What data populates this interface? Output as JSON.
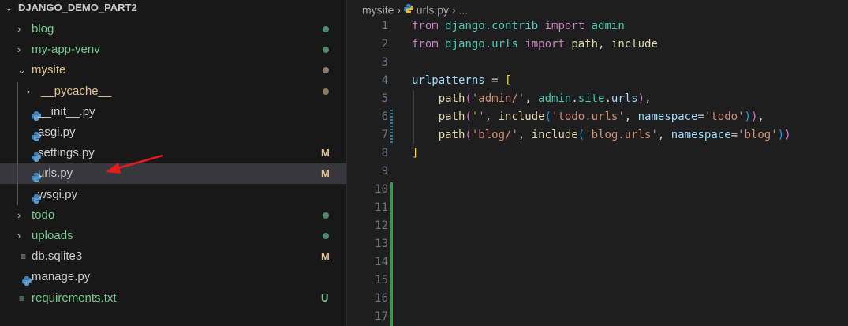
{
  "explorer": {
    "root": "DJANGO_DEMO_PART2",
    "items": [
      {
        "label": "blog",
        "type": "folder",
        "open": false,
        "depth": 1,
        "color": "#73c991",
        "status": "dot",
        "status_color": "#4b8b6b"
      },
      {
        "label": "my-app-venv",
        "type": "folder",
        "open": false,
        "depth": 1,
        "color": "#73c991",
        "status": "dot",
        "status_color": "#4b8b6b"
      },
      {
        "label": "mysite",
        "type": "folder",
        "open": true,
        "depth": 1,
        "color": "#e2c08d",
        "status": "dot",
        "status_color": "#8a7a5e"
      },
      {
        "label": "__pycache__",
        "type": "folder",
        "open": false,
        "depth": 2,
        "color": "#e2c08d",
        "status": "dot",
        "status_color": "#8a7a5e"
      },
      {
        "label": "__init__.py",
        "type": "py",
        "depth": 2,
        "color": "#cccccc",
        "status": ""
      },
      {
        "label": "asgi.py",
        "type": "py",
        "depth": 2,
        "color": "#cccccc",
        "status": ""
      },
      {
        "label": "settings.py",
        "type": "py",
        "depth": 2,
        "color": "#cccccc",
        "status": "M",
        "status_color": "#e2c08d"
      },
      {
        "label": "urls.py",
        "type": "py",
        "depth": 2,
        "color": "#cccccc",
        "status": "M",
        "status_color": "#e2c08d",
        "selected": true
      },
      {
        "label": "wsgi.py",
        "type": "py",
        "depth": 2,
        "color": "#cccccc",
        "status": ""
      },
      {
        "label": "todo",
        "type": "folder",
        "open": false,
        "depth": 1,
        "color": "#73c991",
        "status": "dot",
        "status_color": "#4b8b6b"
      },
      {
        "label": "uploads",
        "type": "folder",
        "open": false,
        "depth": 1,
        "color": "#73c991",
        "status": "dot",
        "status_color": "#4b8b6b"
      },
      {
        "label": "db.sqlite3",
        "type": "db",
        "depth": 1,
        "color": "#cccccc",
        "status": "M",
        "status_color": "#e2c08d"
      },
      {
        "label": "manage.py",
        "type": "py",
        "depth": 1,
        "color": "#cccccc",
        "status": ""
      },
      {
        "label": "requirements.txt",
        "type": "txt",
        "depth": 1,
        "color": "#73c991",
        "status": "U",
        "status_color": "#73c991"
      }
    ]
  },
  "breadcrumb": {
    "folder": "mysite",
    "file": "urls.py",
    "more": "..."
  },
  "code": {
    "line_numbers": [
      "1",
      "2",
      "3",
      "4",
      "5",
      "6",
      "7",
      "8",
      "9",
      "10",
      "11",
      "12",
      "13",
      "14",
      "15",
      "16",
      "17"
    ],
    "lines": [
      [
        [
          "from",
          "kw"
        ],
        [
          " ",
          ""
        ],
        [
          "django.contrib",
          "mod"
        ],
        [
          " ",
          ""
        ],
        [
          "import",
          "kw"
        ],
        [
          " ",
          ""
        ],
        [
          "admin",
          "mod"
        ]
      ],
      [
        [
          "from",
          "kw"
        ],
        [
          " ",
          ""
        ],
        [
          "django.urls",
          "mod"
        ],
        [
          " ",
          ""
        ],
        [
          "import",
          "kw"
        ],
        [
          " ",
          ""
        ],
        [
          "path",
          "fn"
        ],
        [
          ", ",
          ""
        ],
        [
          "include",
          "fn"
        ]
      ],
      [],
      [
        [
          "urlpatterns",
          "var"
        ],
        [
          " = ",
          ""
        ],
        [
          "[",
          "b1"
        ]
      ],
      [
        [
          "    ",
          ""
        ],
        [
          "path",
          "fn"
        ],
        [
          "(",
          "b2"
        ],
        [
          "'admin/'",
          "str"
        ],
        [
          ", ",
          ""
        ],
        [
          "admin",
          "mod"
        ],
        [
          ".",
          ""
        ],
        [
          "site",
          "mod"
        ],
        [
          ".",
          ""
        ],
        [
          "urls",
          "var"
        ],
        [
          ")",
          "b2"
        ],
        [
          ",",
          ""
        ]
      ],
      [
        [
          "    ",
          ""
        ],
        [
          "path",
          "fn"
        ],
        [
          "(",
          "b2"
        ],
        [
          "''",
          "str"
        ],
        [
          ", ",
          ""
        ],
        [
          "include",
          "fn"
        ],
        [
          "(",
          "b3"
        ],
        [
          "'todo.urls'",
          "str"
        ],
        [
          ", ",
          ""
        ],
        [
          "namespace",
          "var"
        ],
        [
          "=",
          ""
        ],
        [
          "'todo'",
          "str"
        ],
        [
          ")",
          "b3"
        ],
        [
          ")",
          "b2"
        ],
        [
          ",",
          ""
        ]
      ],
      [
        [
          "    ",
          ""
        ],
        [
          "path",
          "fn"
        ],
        [
          "(",
          "b2"
        ],
        [
          "'blog/'",
          "str"
        ],
        [
          ", ",
          ""
        ],
        [
          "include",
          "fn"
        ],
        [
          "(",
          "b3"
        ],
        [
          "'blog.urls'",
          "str"
        ],
        [
          ", ",
          ""
        ],
        [
          "namespace",
          "var"
        ],
        [
          "=",
          ""
        ],
        [
          "'blog'",
          "str"
        ],
        [
          ")",
          "b3"
        ],
        [
          ")",
          "b2"
        ]
      ],
      [
        [
          "]",
          "b1"
        ]
      ],
      [],
      [],
      [],
      [],
      [],
      [],
      [],
      [],
      []
    ]
  },
  "colors": {
    "accent_arrow": "#e51c1c",
    "added_bar": "#2ea043",
    "modified_bar": "#1b81a8"
  }
}
